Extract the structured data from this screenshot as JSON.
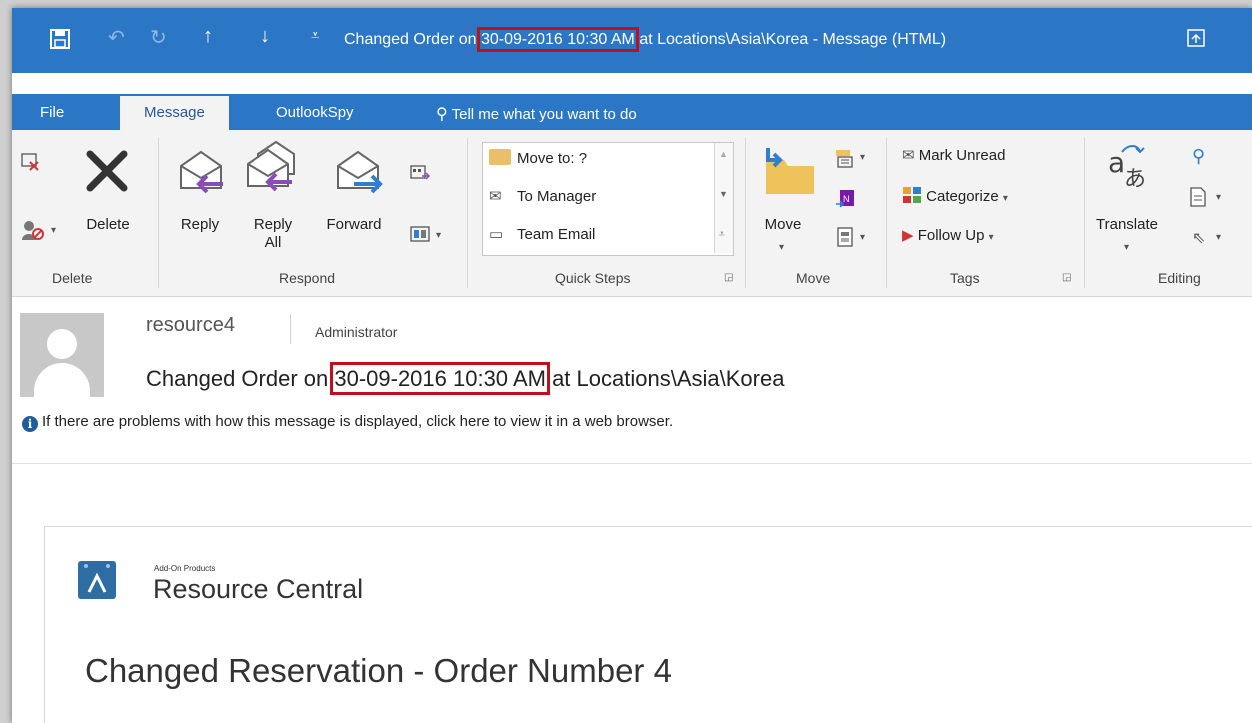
{
  "window": {
    "title_prefix": "Changed Order on ",
    "title_date": "30-09-2016 10:30 AM",
    "title_suffix": " at Locations\\Asia\\Korea - Message (HTML)"
  },
  "tabs": [
    {
      "label": "File"
    },
    {
      "label": "Message"
    },
    {
      "label": "OutlookSpy"
    }
  ],
  "tell_me": "Tell me what you want to do",
  "ribbon": {
    "delete_group": {
      "label": "Delete",
      "delete_button": "Delete"
    },
    "respond_group": {
      "label": "Respond",
      "reply": "Reply",
      "reply_all_1": "Reply",
      "reply_all_2": "All",
      "forward": "Forward"
    },
    "quick_steps": {
      "label": "Quick Steps",
      "items": [
        "Move to: ?",
        "To Manager",
        "Team Email"
      ]
    },
    "move_group": {
      "label": "Move",
      "move_button": "Move"
    },
    "tags_group": {
      "label": "Tags",
      "mark_unread": "Mark Unread",
      "categorize": "Categorize",
      "follow_up": "Follow Up"
    },
    "editing_group": {
      "label": "Editing",
      "translate": "Translate"
    }
  },
  "message": {
    "sender": "resource4",
    "role": "Administrator",
    "subject_prefix": "Changed Order on ",
    "subject_date": "30-09-2016 10:30 AM",
    "subject_suffix": " at Locations\\Asia\\Korea",
    "info": "If there are problems with how this message is displayed, click here to view it in a web browser."
  },
  "body": {
    "brand_small": "Add-On Products",
    "brand": "Resource Central",
    "heading": "Changed Reservation - Order Number 4"
  },
  "colors": {
    "accent": "#2b77c6",
    "highlight": "#c0101c",
    "purple_arrow": "#8b4bb8",
    "blue_arrow": "#2f7fd1"
  }
}
